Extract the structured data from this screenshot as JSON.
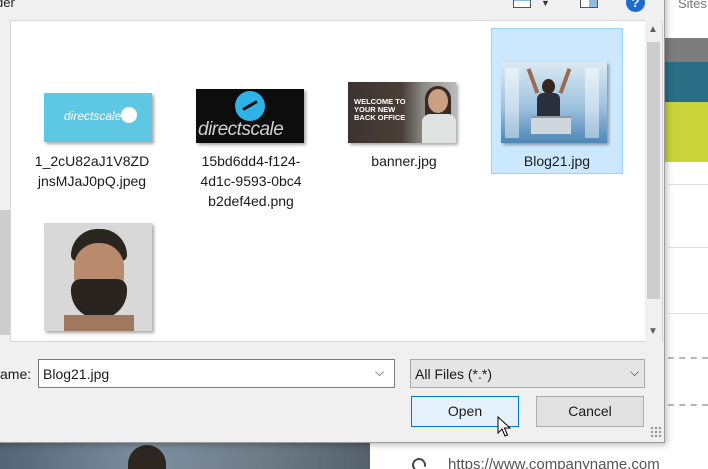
{
  "dialog": {
    "title_fragment": "der",
    "help_label": "?"
  },
  "background": {
    "top_text": "Sites",
    "link_text": "https://www.companyname.com"
  },
  "files": [
    {
      "name": "1_2cU82aJ1V8ZDjnsMJaJ0pQ.jpeg",
      "line1": "1_2cU82aJ1V8ZD",
      "line2": "jnsMJaJ0pQ.jpeg",
      "line3": "",
      "thumb_text": "directscale",
      "selected": false
    },
    {
      "name": "15bd6dd4-f124-4d1c-9593-0bc4b2def4ed.png",
      "line1": "15bd6dd4-f124-",
      "line2": "4d1c-9593-0bc4",
      "line3": "b2def4ed.png",
      "thumb_text": "directscale",
      "selected": false
    },
    {
      "name": "banner.jpg",
      "line1": "banner.jpg",
      "line2": "",
      "line3": "",
      "thumb_text": "WELCOME TO YOUR NEW BACK OFFICE",
      "selected": false
    },
    {
      "name": "Blog21.jpg",
      "line1": "Blog21.jpg",
      "line2": "",
      "line3": "",
      "thumb_text": "",
      "selected": true
    },
    {
      "name": "",
      "line1": "",
      "line2": "",
      "line3": "",
      "thumb_text": "",
      "selected": false
    }
  ],
  "filename_row": {
    "label": "ame:",
    "value": "Blog21.jpg"
  },
  "filetype": {
    "selected": "All Files (*.*)"
  },
  "buttons": {
    "open": "Open",
    "cancel": "Cancel"
  },
  "colors": {
    "selection_bg": "#cce8ff",
    "selection_border": "#99d1ff",
    "default_button_border": "#0078d7",
    "help_icon": "#1c6ccd"
  }
}
